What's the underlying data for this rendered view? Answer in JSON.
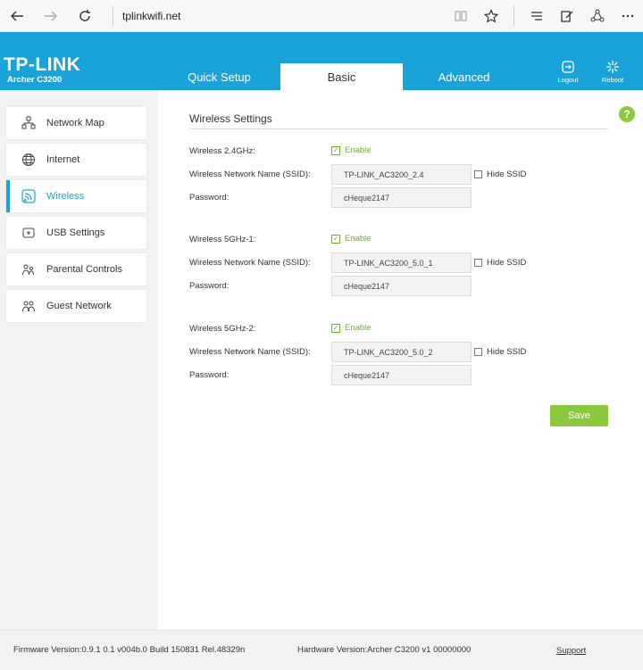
{
  "browser": {
    "url": "tplinkwifi.net"
  },
  "header": {
    "logo": "TP-LINK",
    "model": "Archer C3200",
    "tabs": [
      {
        "label": "Quick Setup",
        "active": false
      },
      {
        "label": "Basic",
        "active": true
      },
      {
        "label": "Advanced",
        "active": false
      }
    ],
    "logout_label": "Logout",
    "reboot_label": "Reboot",
    "accent_color": "#1aa3d9"
  },
  "sidebar": {
    "items": [
      {
        "label": "Network Map",
        "icon": "network-map-icon",
        "active": false
      },
      {
        "label": "Internet",
        "icon": "globe-icon",
        "active": false
      },
      {
        "label": "Wireless",
        "icon": "wireless-icon",
        "active": true
      },
      {
        "label": "USB Settings",
        "icon": "usb-icon",
        "active": false
      },
      {
        "label": "Parental Controls",
        "icon": "parental-controls-icon",
        "active": false
      },
      {
        "label": "Guest Network",
        "icon": "guest-network-icon",
        "active": false
      }
    ]
  },
  "main": {
    "title": "Wireless Settings",
    "help_label": "?",
    "bands": [
      {
        "label": "Wireless 2.4GHz:",
        "enable_label": "Enable",
        "enabled": true,
        "ssid_label": "Wireless Network Name (SSID):",
        "ssid": "TP-LINK_AC3200_2.4",
        "hide_label": "Hide SSID",
        "password_label": "Password:",
        "password": "cHeque2147"
      },
      {
        "label": "Wireless 5GHz-1:",
        "enable_label": "Enable",
        "enabled": true,
        "ssid_label": "Wireless Network Name (SSID):",
        "ssid": "TP-LINK_AC3200_5.0_1",
        "hide_label": "Hide SSID",
        "password_label": "Password:",
        "password": "cHeque2147"
      },
      {
        "label": "Wireless 5GHz-2:",
        "enable_label": "Enable",
        "enabled": true,
        "ssid_label": "Wireless Network Name (SSID):",
        "ssid": "TP-LINK_AC3200_5.0_2",
        "hide_label": "Hide SSID",
        "password_label": "Password:",
        "password": "cHeque2147"
      }
    ],
    "save_label": "Save",
    "save_color": "#8dc63f"
  },
  "footer": {
    "firmware": "Firmware Version:0.9.1 0.1 v004b.0 Build 150831 Rel.48329n",
    "hardware": "Hardware Version:Archer C3200 v1 00000000",
    "support": "Support"
  }
}
